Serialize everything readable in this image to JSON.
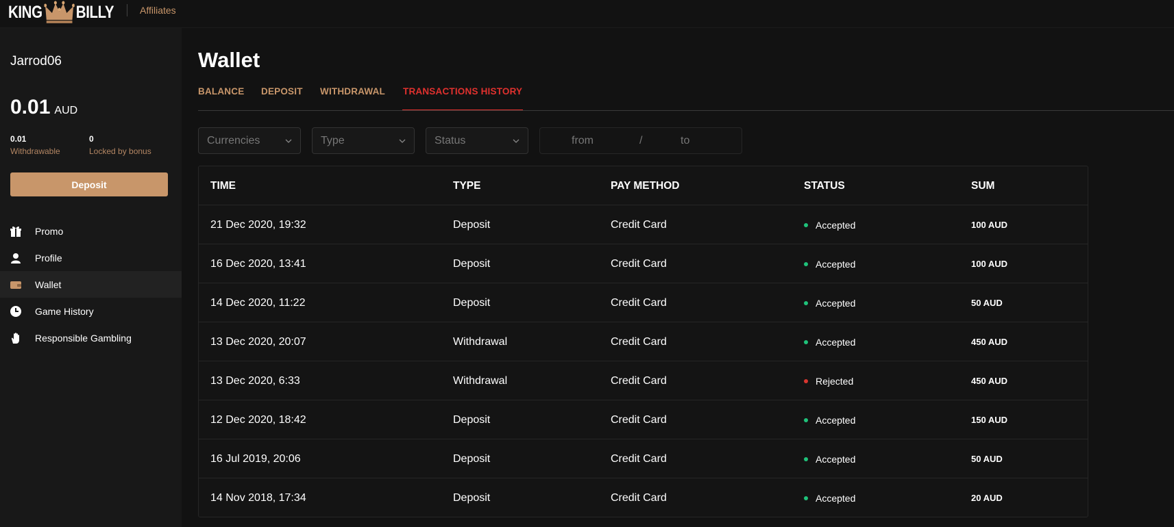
{
  "header": {
    "logo_left": "KING",
    "logo_right": "BILLY",
    "affiliates_link": "Affiliates"
  },
  "sidebar": {
    "username": "Jarrod06",
    "balance_amount": "0.01",
    "balance_currency": "AUD",
    "withdrawable_value": "0.01",
    "withdrawable_label": "Withdrawable",
    "locked_value": "0",
    "locked_label": "Locked by bonus",
    "deposit_button": "Deposit",
    "nav": [
      {
        "label": "Promo",
        "icon": "gift-icon"
      },
      {
        "label": "Profile",
        "icon": "user-icon"
      },
      {
        "label": "Wallet",
        "icon": "wallet-icon",
        "active": true
      },
      {
        "label": "Game History",
        "icon": "clock-icon"
      },
      {
        "label": "Responsible Gambling",
        "icon": "hand-icon"
      }
    ]
  },
  "main": {
    "title": "Wallet",
    "tabs": [
      {
        "label": "BALANCE"
      },
      {
        "label": "DEPOSIT"
      },
      {
        "label": "WITHDRAWAL"
      },
      {
        "label": "TRANSACTIONS HISTORY",
        "active": true
      }
    ],
    "filters": {
      "currencies": "Currencies",
      "type": "Type",
      "status": "Status",
      "date_from": "from",
      "date_separator": "/",
      "date_to": "to"
    },
    "table": {
      "columns": [
        "TIME",
        "TYPE",
        "PAY METHOD",
        "STATUS",
        "SUM"
      ],
      "rows": [
        {
          "time": "21 Dec 2020, 19:32",
          "type": "Deposit",
          "method": "Credit Card",
          "status": "Accepted",
          "sum": "100 AUD"
        },
        {
          "time": "16 Dec 2020, 13:41",
          "type": "Deposit",
          "method": "Credit Card",
          "status": "Accepted",
          "sum": "100 AUD"
        },
        {
          "time": "14 Dec 2020, 11:22",
          "type": "Deposit",
          "method": "Credit Card",
          "status": "Accepted",
          "sum": "50 AUD"
        },
        {
          "time": "13 Dec 2020, 20:07",
          "type": "Withdrawal",
          "method": "Credit Card",
          "status": "Accepted",
          "sum": "450 AUD"
        },
        {
          "time": "13 Dec 2020, 6:33",
          "type": "Withdrawal",
          "method": "Credit Card",
          "status": "Rejected",
          "sum": "450 AUD"
        },
        {
          "time": "12 Dec 2020, 18:42",
          "type": "Deposit",
          "method": "Credit Card",
          "status": "Accepted",
          "sum": "150 AUD"
        },
        {
          "time": "16 Jul 2019, 20:06",
          "type": "Deposit",
          "method": "Credit Card",
          "status": "Accepted",
          "sum": "50 AUD"
        },
        {
          "time": "14 Nov 2018, 17:34",
          "type": "Deposit",
          "method": "Credit Card",
          "status": "Accepted",
          "sum": "20 AUD"
        }
      ]
    }
  },
  "colors": {
    "accent_gold": "#c8966a",
    "active_tab_red": "#e0312e",
    "status_accepted": "#1fc27a",
    "status_rejected": "#d8352f"
  }
}
